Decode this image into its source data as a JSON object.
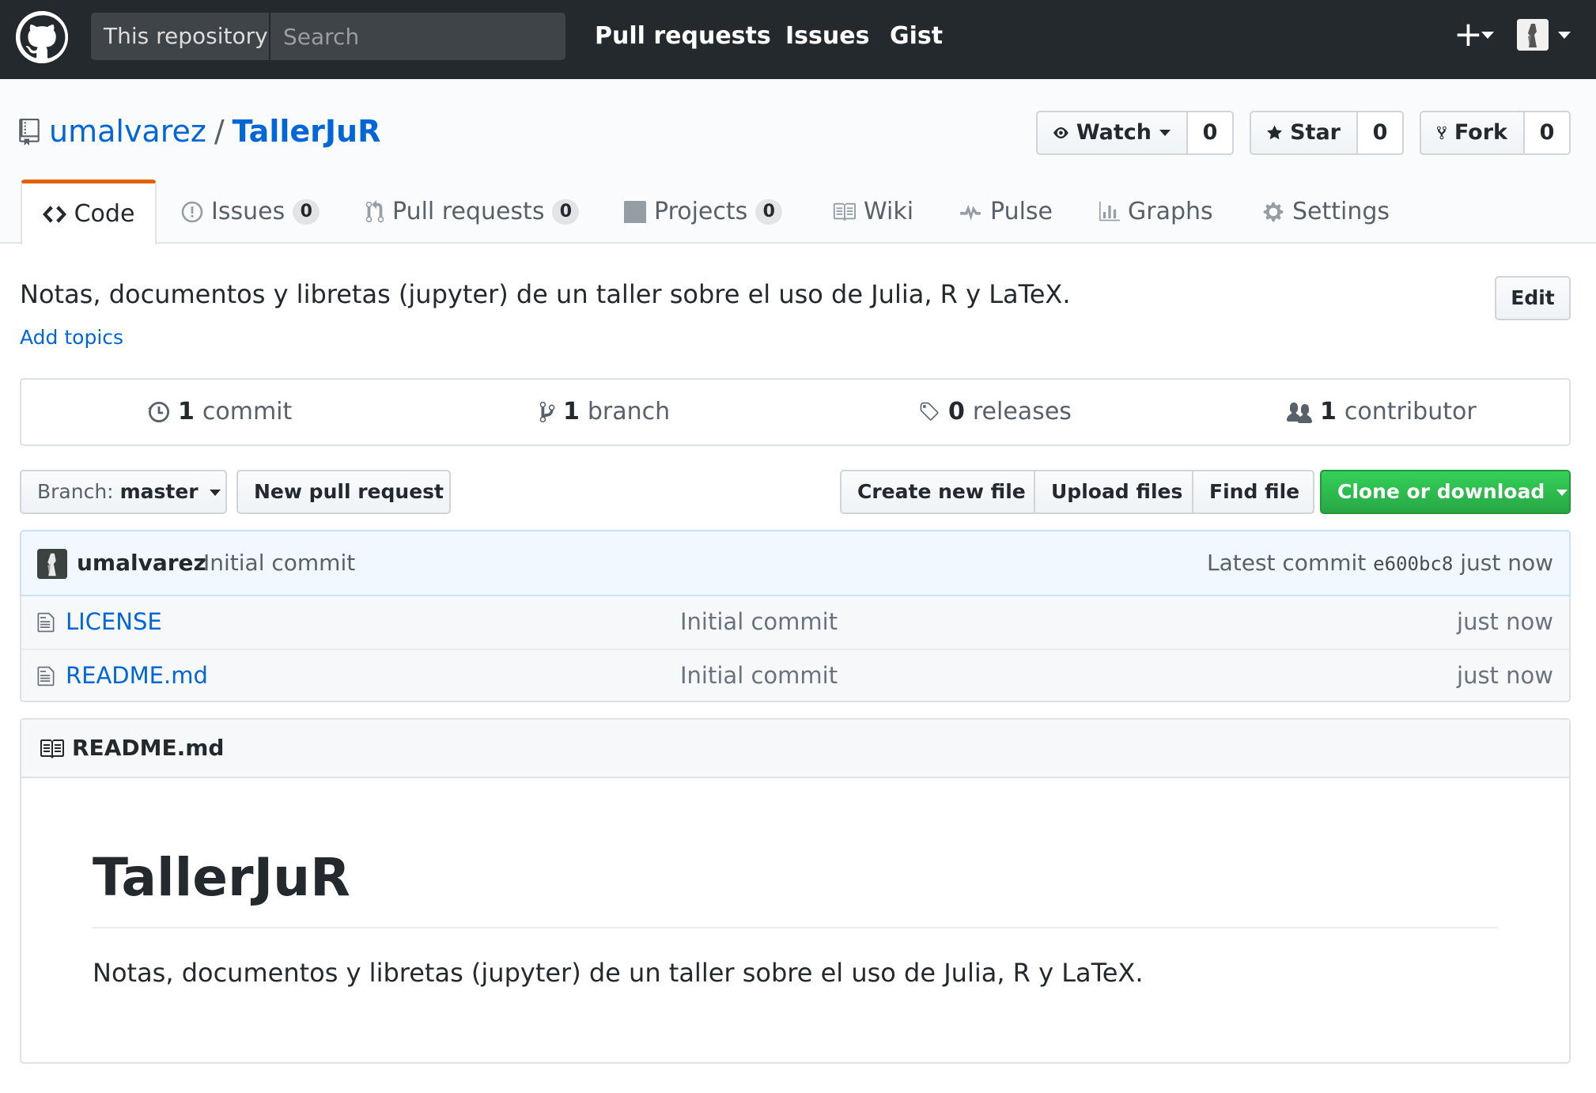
{
  "header": {
    "scope_label": "This repository",
    "search_placeholder": "Search",
    "nav": [
      "Pull requests",
      "Issues",
      "Gist"
    ],
    "new_icon": "plus-icon",
    "colors": {
      "bg": "#24292e"
    }
  },
  "repo": {
    "owner": "umalvarez",
    "separator": "/",
    "name": "TallerJuR",
    "watch_label": "Watch",
    "watch_count": "0",
    "star_label": "Star",
    "star_count": "0",
    "fork_label": "Fork",
    "fork_count": "0"
  },
  "tabs": [
    {
      "label": "Code",
      "icon": "code-icon",
      "selected": true
    },
    {
      "label": "Issues",
      "count": "0",
      "icon": "issue-icon"
    },
    {
      "label": "Pull requests",
      "count": "0",
      "icon": "pull-request-icon"
    },
    {
      "label": "Projects",
      "count": "0",
      "icon": "project-icon"
    },
    {
      "label": "Wiki",
      "icon": "book-icon"
    },
    {
      "label": "Pulse",
      "icon": "pulse-icon"
    },
    {
      "label": "Graphs",
      "icon": "graph-icon"
    },
    {
      "label": "Settings",
      "icon": "gear-icon"
    }
  ],
  "description": {
    "text": "Notas, documentos y libretas (jupyter) de un taller sobre el uso de Julia, R y LaTeX.",
    "add_topics": "Add topics",
    "edit_label": "Edit"
  },
  "summary": {
    "commits": {
      "num": "1",
      "label": "commit"
    },
    "branches": {
      "num": "1",
      "label": "branch"
    },
    "releases": {
      "num": "0",
      "label": "releases"
    },
    "contributors": {
      "num": "1",
      "label": "contributor"
    }
  },
  "file_nav": {
    "branch_prefix": "Branch:",
    "branch_name": "master",
    "new_pr": "New pull request",
    "create_file": "Create new file",
    "upload_files": "Upload files",
    "find_file": "Find file",
    "clone": "Clone or download",
    "clone_color": "#28a745"
  },
  "commit_tease": {
    "author": "umalvarez",
    "message": "Initial commit",
    "latest_label": "Latest commit",
    "sha": "e600bc8",
    "age": "just now"
  },
  "files": [
    {
      "name": "LICENSE",
      "message": "Initial commit",
      "age": "just now"
    },
    {
      "name": "README.md",
      "message": "Initial commit",
      "age": "just now"
    }
  ],
  "readme": {
    "filename": "README.md",
    "heading": "TallerJuR",
    "paragraph": "Notas, documentos y libretas (jupyter) de un taller sobre el uso de Julia, R y LaTeX."
  }
}
